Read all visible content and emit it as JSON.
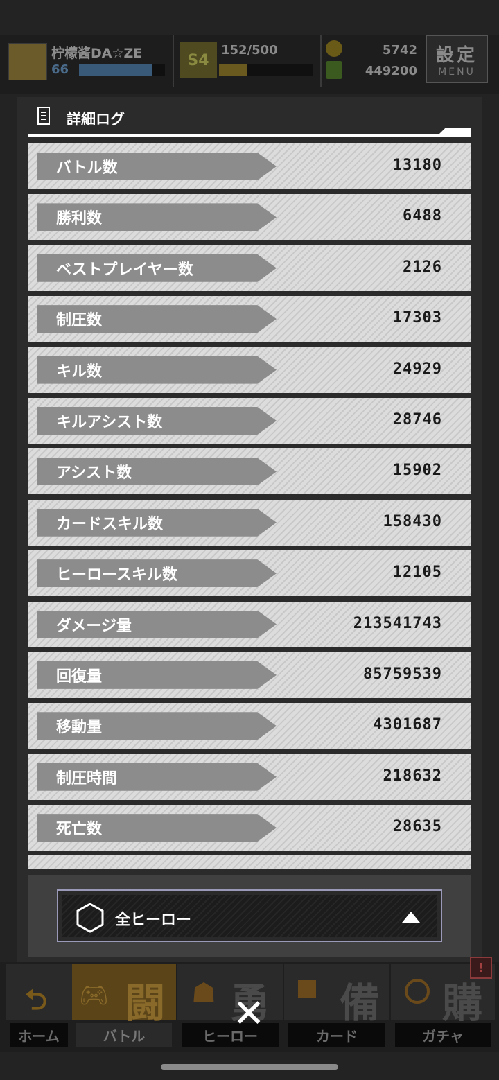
{
  "header": {
    "player_name": "柠檬酱DA☆ZE",
    "player_level": "66",
    "player_level_progress": 0.85,
    "rank_value": "152/500",
    "rank_progress": 0.3,
    "coins": "5742",
    "gems": "449200",
    "menu_kanji": "設定",
    "menu_label": "MENU"
  },
  "log": {
    "title": "詳細ログ",
    "rows": [
      {
        "label": "バトル数",
        "value": "13180"
      },
      {
        "label": "勝利数",
        "value": "6488"
      },
      {
        "label": "ベストプレイヤー数",
        "value": "2126"
      },
      {
        "label": "制圧数",
        "value": "17303"
      },
      {
        "label": "キル数",
        "value": "24929"
      },
      {
        "label": "キルアシスト数",
        "value": "28746"
      },
      {
        "label": "アシスト数",
        "value": "15902"
      },
      {
        "label": "カードスキル数",
        "value": "158430"
      },
      {
        "label": "ヒーロースキル数",
        "value": "12105"
      },
      {
        "label": "ダメージ量",
        "value": "213541743"
      },
      {
        "label": "回復量",
        "value": "85759539"
      },
      {
        "label": "移動量",
        "value": "4301687"
      },
      {
        "label": "制圧時間",
        "value": "218632"
      },
      {
        "label": "死亡数",
        "value": "28635"
      }
    ]
  },
  "filter": {
    "selected": "全ヒーロー"
  },
  "nav": {
    "home": "ホーム",
    "battle": "バトル",
    "battle_kanji": "闘",
    "hero": "ヒーロー",
    "hero_kanji": "勇",
    "card": "カード",
    "card_kanji": "備",
    "gacha": "ガチャ",
    "gacha_kanji": "購",
    "alert": "!"
  },
  "close_symbol": "✕"
}
